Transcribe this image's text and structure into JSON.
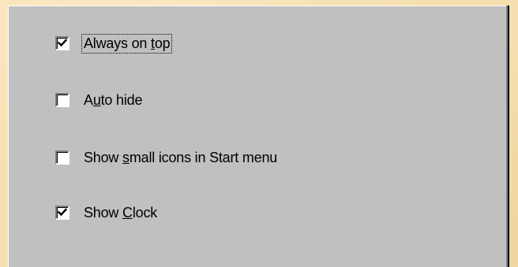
{
  "taskbar_options": {
    "items": [
      {
        "label_before": "Always on ",
        "mnemonic": "t",
        "label_after": "op",
        "checked": true,
        "focused": true
      },
      {
        "label_before": "A",
        "mnemonic": "u",
        "label_after": "to hide",
        "checked": false,
        "focused": false
      },
      {
        "label_before": "Show ",
        "mnemonic": "s",
        "label_after": "mall icons in Start menu",
        "checked": false,
        "focused": false
      },
      {
        "label_before": "Show ",
        "mnemonic": "C",
        "label_after": "lock",
        "checked": true,
        "focused": false
      }
    ]
  },
  "colors": {
    "background": "#f5dfae",
    "panel": "#c0c0c0",
    "checkbox_fill": "#ffffff",
    "text": "#000000"
  },
  "icons": {
    "check": "checkmark-icon"
  }
}
